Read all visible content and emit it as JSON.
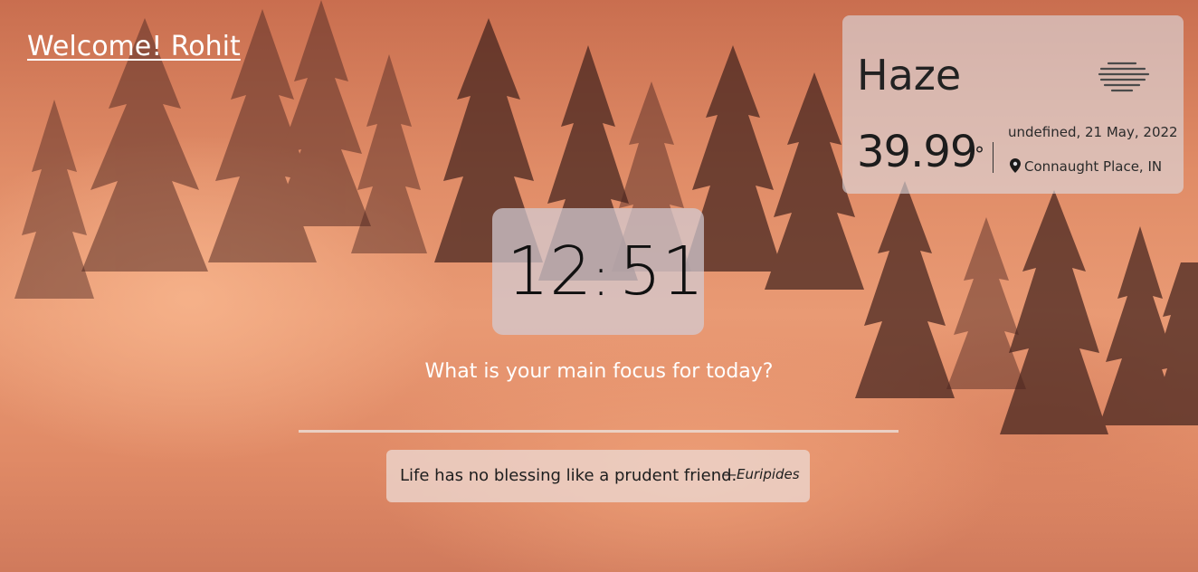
{
  "greeting": {
    "text": "Welcome! Rohit"
  },
  "weather": {
    "condition": "Haze",
    "icon": "haze-icon",
    "temperature": "39.99",
    "degree_symbol": "°",
    "date": "undefined, 21 May, 2022",
    "location_icon": "map-pin-icon",
    "location": "Connaught Place, IN"
  },
  "clock": {
    "hours": "12",
    "separator": ":",
    "minutes": "51"
  },
  "focus": {
    "question": "What is your main focus for today?",
    "value": "",
    "placeholder": ""
  },
  "quote": {
    "text": "Life has no blessing like a prudent friend.",
    "author": "—Euripides"
  },
  "colors": {
    "background_top": "#c96e4f",
    "background_mid": "#e99a74",
    "card_gray": "#dcdce2",
    "text_dark": "#1c1c1c",
    "text_light": "#ffffff"
  }
}
